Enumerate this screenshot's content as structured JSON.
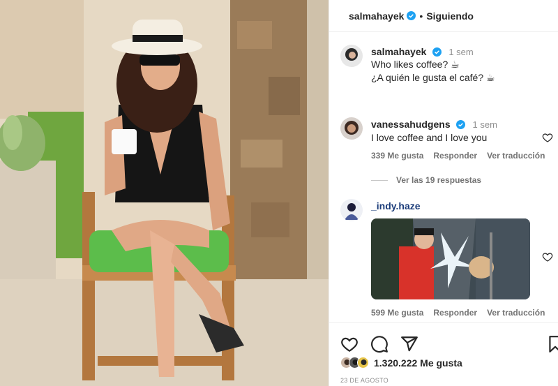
{
  "post": {
    "author": "salmahayek",
    "follow_status": "Siguiendo",
    "separator": "•",
    "caption": {
      "author": "salmahayek",
      "time": "1 sem",
      "line1": "Who likes coffee? ☕",
      "line2": "¿A quién le gusta el café? ☕"
    },
    "likes": "1.320.222 Me gusta",
    "date": "23 DE AGOSTO"
  },
  "comments": [
    {
      "author": "vanessahudgens",
      "time": "1 sem",
      "text": "I love coffee and I love you",
      "likes": "339 Me gusta",
      "reply": "Responder",
      "translate": "Ver traducción"
    },
    {
      "author": "_indy.haze",
      "text": "",
      "likes": "599 Me gusta",
      "reply": "Responder",
      "translate": "Ver traducción"
    }
  ],
  "view_replies": "Ver las 19 respuestas",
  "colors": {
    "verified": "#1DA1F2",
    "text": "#262626",
    "meta": "#737373",
    "border": "#efefef"
  },
  "icons": [
    "verified-badge-icon",
    "heart-icon",
    "comment-icon",
    "share-icon",
    "bookmark-icon"
  ]
}
